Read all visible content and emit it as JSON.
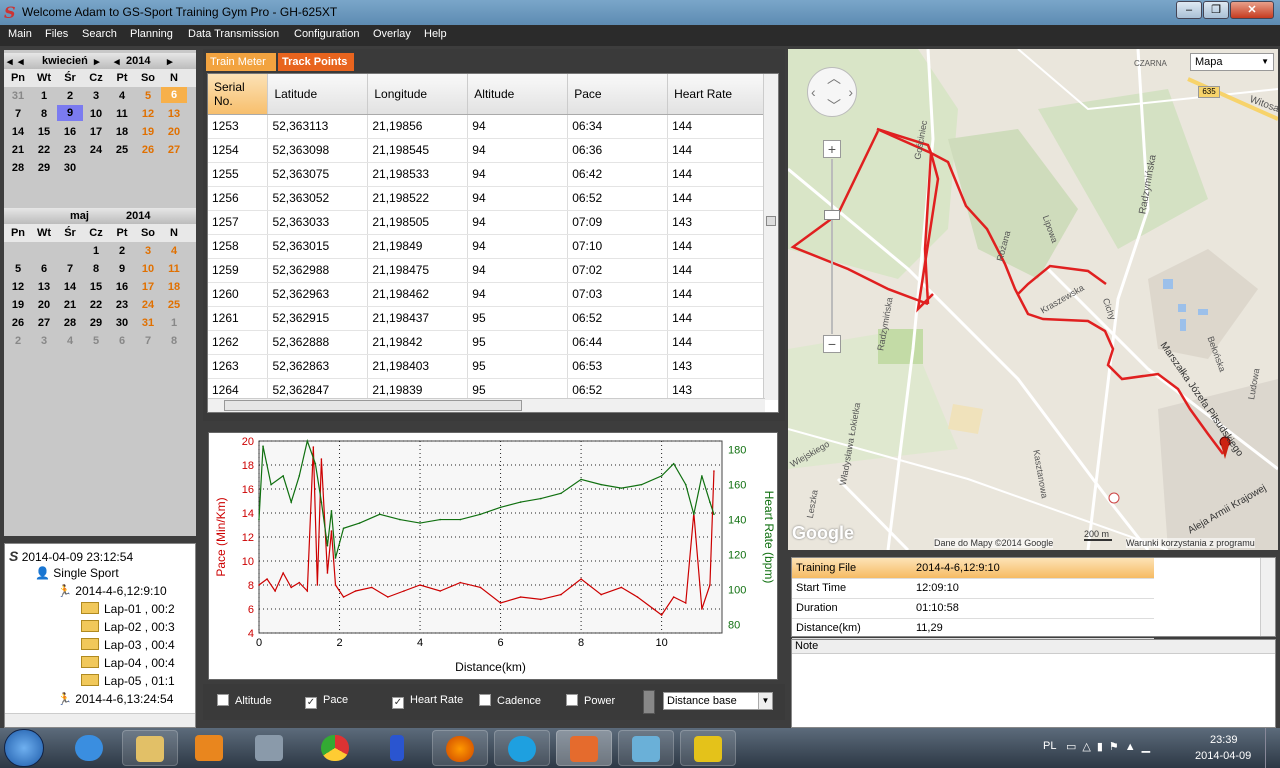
{
  "window": {
    "title": "Welcome Adam to GS-Sport Training Gym Pro - GH-625XT"
  },
  "menu": [
    "Main",
    "Files",
    "Search",
    "Planning",
    "Data Transmission",
    "Configuration",
    "Overlay",
    "Help"
  ],
  "calendar": {
    "weekdays": [
      "Pn",
      "Wt",
      "Śr",
      "Cz",
      "Pt",
      "So",
      "N"
    ],
    "april": {
      "month": "kwiecień",
      "year": "2014",
      "rows": [
        [
          "31",
          "1",
          "2",
          "3",
          "4",
          "5",
          "6"
        ],
        [
          "7",
          "8",
          "9",
          "10",
          "11",
          "12",
          "13"
        ],
        [
          "14",
          "15",
          "16",
          "17",
          "18",
          "19",
          "20"
        ],
        [
          "21",
          "22",
          "23",
          "24",
          "25",
          "26",
          "27"
        ],
        [
          "28",
          "29",
          "30",
          "",
          "",
          "",
          ""
        ]
      ]
    },
    "may": {
      "month": "maj",
      "year": "2014",
      "rows": [
        [
          "",
          "",
          "",
          "1",
          "2",
          "3",
          "4"
        ],
        [
          "5",
          "6",
          "7",
          "8",
          "9",
          "10",
          "11"
        ],
        [
          "12",
          "13",
          "14",
          "15",
          "16",
          "17",
          "18"
        ],
        [
          "19",
          "20",
          "21",
          "22",
          "23",
          "24",
          "25"
        ],
        [
          "26",
          "27",
          "28",
          "29",
          "30",
          "31",
          "1"
        ],
        [
          "2",
          "3",
          "4",
          "5",
          "6",
          "7",
          "8"
        ]
      ]
    },
    "selected_day": "9",
    "today_day": "6"
  },
  "tree": {
    "date": "2014-04-09 23:12:54",
    "sport": "Single Sport",
    "session1": "2014-4-6,12:9:10",
    "laps": [
      "Lap-01 , 00:2",
      "Lap-02 , 00:3",
      "Lap-03 , 00:4",
      "Lap-04 , 00:4",
      "Lap-05 , 01:1"
    ],
    "session2": "2014-4-6,13:24:54"
  },
  "tabs": {
    "train_meter": "Train Meter",
    "track_points": "Track Points"
  },
  "grid": {
    "headers": [
      "Serial\nNo.",
      "Latitude",
      "Longitude",
      "Altitude",
      "Pace",
      "Heart Rate"
    ],
    "rows": [
      [
        "1253",
        "52,363113",
        "21,19856",
        "94",
        "06:34",
        "144"
      ],
      [
        "1254",
        "52,363098",
        "21,198545",
        "94",
        "06:36",
        "144"
      ],
      [
        "1255",
        "52,363075",
        "21,198533",
        "94",
        "06:42",
        "144"
      ],
      [
        "1256",
        "52,363052",
        "21,198522",
        "94",
        "06:52",
        "144"
      ],
      [
        "1257",
        "52,363033",
        "21,198505",
        "94",
        "07:09",
        "143"
      ],
      [
        "1258",
        "52,363015",
        "21,19849",
        "94",
        "07:10",
        "144"
      ],
      [
        "1259",
        "52,362988",
        "21,198475",
        "94",
        "07:02",
        "144"
      ],
      [
        "1260",
        "52,362963",
        "21,198462",
        "94",
        "07:03",
        "144"
      ],
      [
        "1261",
        "52,362915",
        "21,198437",
        "95",
        "06:52",
        "144"
      ],
      [
        "1262",
        "52,362888",
        "21,19842",
        "95",
        "06:44",
        "144"
      ],
      [
        "1263",
        "52,362863",
        "21,198403",
        "95",
        "06:53",
        "143"
      ],
      [
        "1264",
        "52,362847",
        "21,19839",
        "95",
        "06:52",
        "143"
      ]
    ]
  },
  "chart_data": {
    "type": "line",
    "xlabel": "Distance(km)",
    "ylabel": "Pace (Min/Km)",
    "y2label": "Heart Rate (bpm)",
    "xlim": [
      0,
      11.5
    ],
    "ylim": [
      4,
      20
    ],
    "y2lim": [
      75,
      185
    ],
    "x_ticks": [
      "0",
      "2",
      "4",
      "6",
      "8",
      "10"
    ],
    "y_ticks": [
      "4",
      "6",
      "8",
      "10",
      "12",
      "14",
      "16",
      "18",
      "20"
    ],
    "y2_ticks": [
      "80",
      "100",
      "120",
      "140",
      "160",
      "180"
    ],
    "series": [
      {
        "name": "Pace",
        "color": "#cc0000",
        "x": [
          0,
          0.2,
          0.4,
          0.6,
          0.8,
          1.0,
          1.2,
          1.35,
          1.45,
          1.55,
          1.7,
          1.8,
          1.9,
          2.1,
          2.4,
          2.8,
          3.2,
          3.6,
          4.0,
          4.5,
          5.0,
          5.5,
          6.0,
          6.5,
          7.0,
          7.5,
          8.0,
          8.5,
          9.0,
          9.4,
          9.8,
          10.0,
          10.3,
          10.6,
          10.8,
          11.0,
          11.2,
          11.3
        ],
        "values": [
          8,
          8.5,
          7.5,
          9,
          7.8,
          8.2,
          7.5,
          19.5,
          8,
          18.5,
          9,
          12.5,
          8,
          7,
          7.5,
          7.8,
          7,
          7.5,
          8,
          7.5,
          8.2,
          7.8,
          6.5,
          7,
          6.8,
          7.2,
          8.5,
          7.2,
          7.8,
          7,
          6,
          5.5,
          7,
          6.5,
          14,
          6,
          8,
          17.5
        ]
      },
      {
        "name": "Heart Rate",
        "color": "#107010",
        "x": [
          0,
          0.1,
          0.3,
          0.6,
          0.8,
          1.0,
          1.2,
          1.4,
          1.55,
          1.7,
          1.8,
          1.9,
          2.1,
          2.5,
          3.0,
          3.5,
          4.0,
          4.5,
          5.0,
          5.5,
          6.0,
          6.5,
          7.0,
          7.5,
          8.0,
          8.5,
          9.0,
          9.5,
          10.0,
          10.3,
          10.6,
          10.8,
          11.0,
          11.2,
          11.3
        ],
        "values": [
          140,
          182,
          160,
          165,
          150,
          165,
          185,
          172,
          150,
          125,
          145,
          118,
          135,
          138,
          143,
          140,
          138,
          140,
          140,
          143,
          147,
          150,
          152,
          155,
          163,
          160,
          158,
          160,
          165,
          172,
          160,
          143,
          165,
          150,
          143
        ]
      }
    ]
  },
  "chart_controls": {
    "altitude": "Altitude",
    "pace": "Pace",
    "heart_rate": "Heart Rate",
    "cadence": "Cadence",
    "power": "Power",
    "dropdown": "Distance base"
  },
  "map": {
    "type_select": "Mapa",
    "labels": [
      "CZARNA",
      "Witosa",
      "Gościniec",
      "Radzymińska",
      "Różana",
      "Lipowa",
      "Kraszewska",
      "Cichy",
      "Bełońska",
      "Marszałka Józefa Piłsudskiego",
      "Ludowa",
      "Radzymińska",
      "Władysława Łokietka",
      "Wiejskiego",
      "Leszka",
      "Kasztanowa",
      "Aleja Armii Krajowej",
      "Gościniec"
    ],
    "road_number": "635",
    "scale": "200 m",
    "attribution": "Dane do Mapy ©2014 Google",
    "terms": "Warunki korzystania z programu",
    "google": "Google"
  },
  "info": {
    "rows": [
      [
        "Training File",
        "2014-4-6,12:9:10"
      ],
      [
        "Start Time",
        "12:09:10"
      ],
      [
        "Duration",
        "01:10:58"
      ],
      [
        "Distance(km)",
        "11,29"
      ]
    ],
    "note_label": "Note"
  },
  "taskbar": {
    "lang": "PL",
    "time": "23:39",
    "date": "2014-04-09"
  }
}
